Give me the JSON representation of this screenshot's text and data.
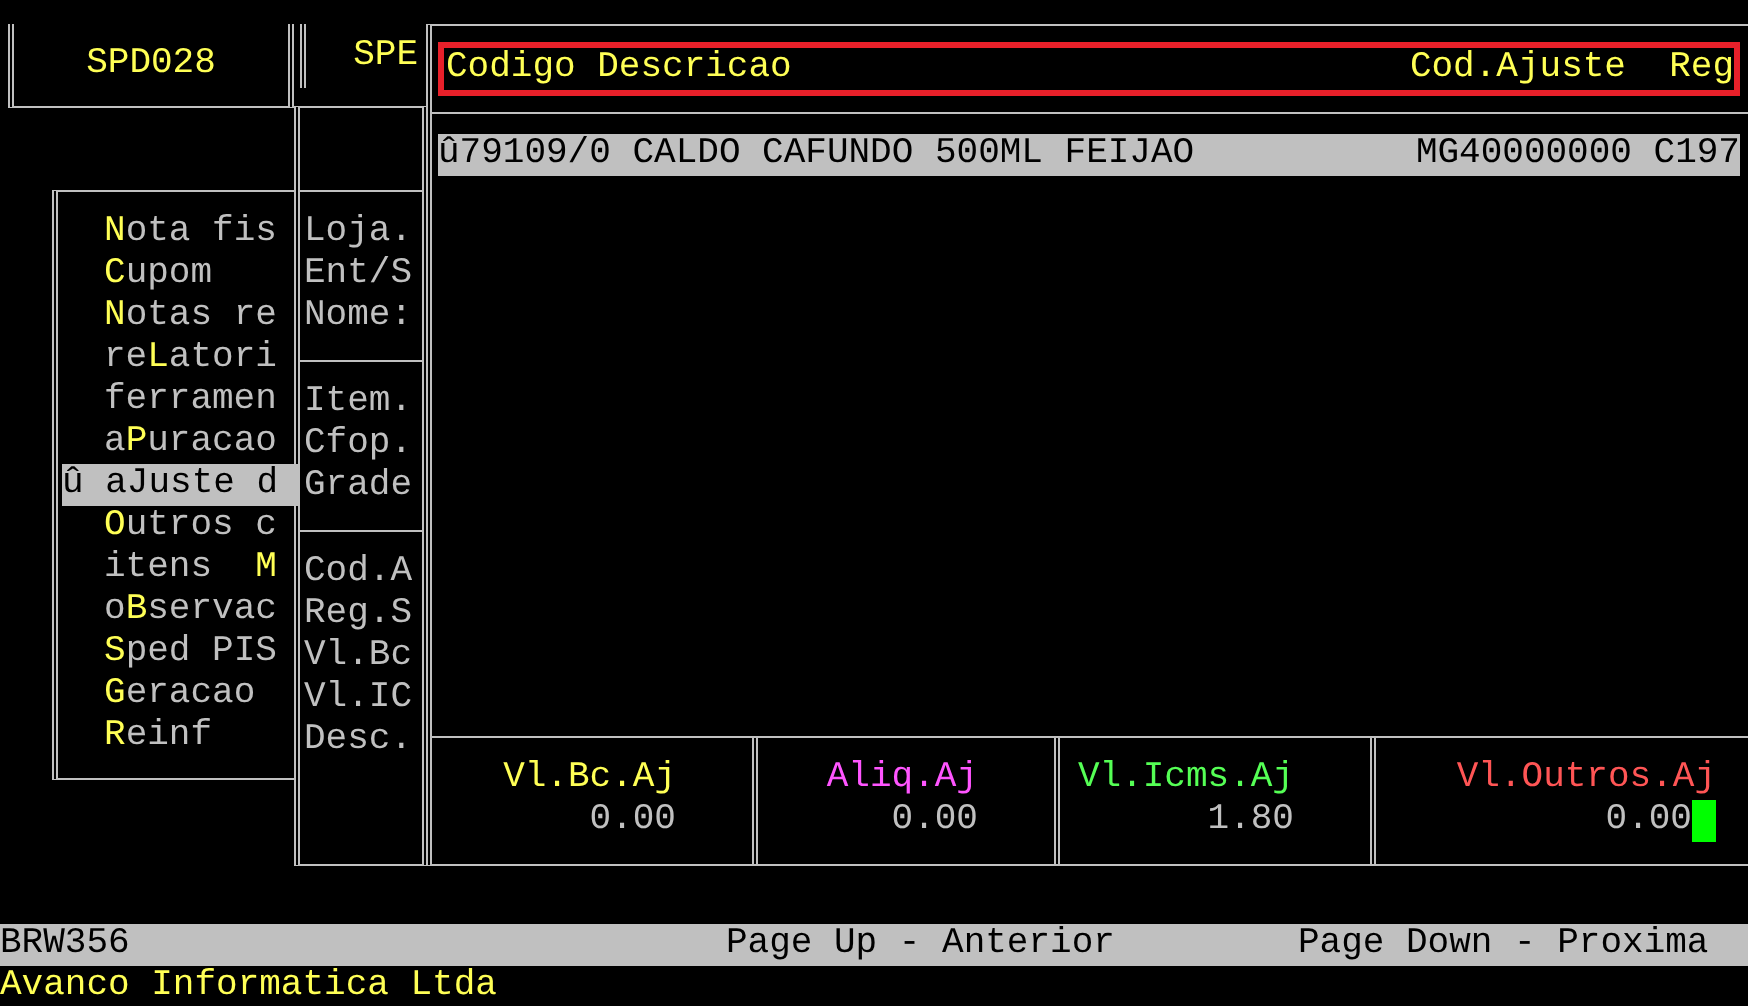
{
  "program_box": {
    "title": "SPD028"
  },
  "sub_box": {
    "title": "SPE"
  },
  "menu": [
    {
      "key": "N",
      "post": "ota fis",
      "selected": false
    },
    {
      "key": "C",
      "post": "upom",
      "selected": false
    },
    {
      "key": "N",
      "post": "otas re",
      "selected": false
    },
    {
      "pre": "re",
      "key": "L",
      "post": "atori",
      "selected": false
    },
    {
      "pre": "ferramen",
      "selected": false
    },
    {
      "pre": "a",
      "key": "P",
      "post": "uracao",
      "selected": false
    },
    {
      "pre": "û a",
      "key": "J",
      "post": "uste d",
      "selected": true
    },
    {
      "key": "O",
      "post": "utros c",
      "selected": false
    },
    {
      "pre": "itens  ",
      "key": "M",
      "selected": false
    },
    {
      "pre": "o",
      "key": "B",
      "post": "servac",
      "selected": false
    },
    {
      "key": "S",
      "post": "ped PIS",
      "selected": false
    },
    {
      "key": "G",
      "post": "eracao",
      "selected": false
    },
    {
      "key": "R",
      "post": "einf",
      "selected": false
    }
  ],
  "field_labels": [
    [
      "Loja.",
      "Ent/S",
      "Nome:"
    ],
    [
      "Item.",
      "Cfop.",
      "Grade"
    ],
    [
      "Cod.A",
      "Reg.S",
      "Vl.Bc",
      "Vl.IC",
      "Desc."
    ]
  ],
  "browse": {
    "columns": [
      "Codigo",
      "Descricao",
      "Cod.Ajuste",
      "Reg"
    ],
    "rows": [
      {
        "cells": [
          "û79109/0",
          "CALDO CAFUNDO 500ML FEIJAO",
          "MG40000000",
          "C197"
        ],
        "selected": true
      }
    ]
  },
  "totals": [
    {
      "label": "Vl.Bc.Aj",
      "value": "0.00",
      "color": "#ffff55",
      "cursor": false
    },
    {
      "label": "Aliq.Aj",
      "value": "0.00",
      "color": "#ff55ff",
      "cursor": false
    },
    {
      "label": "Vl.Icms.Aj",
      "value": "1.80",
      "color": "#55ff55",
      "cursor": false
    },
    {
      "label": "Vl.Outros.Aj",
      "value": "0.00",
      "color": "#ff5555",
      "cursor": true
    }
  ],
  "status_bar": {
    "code": "BRW356",
    "prev_hint": "Page Up - Anterior",
    "next_hint": "Page Down - Proxima"
  },
  "footer": "Avanco Informatica Ltda"
}
